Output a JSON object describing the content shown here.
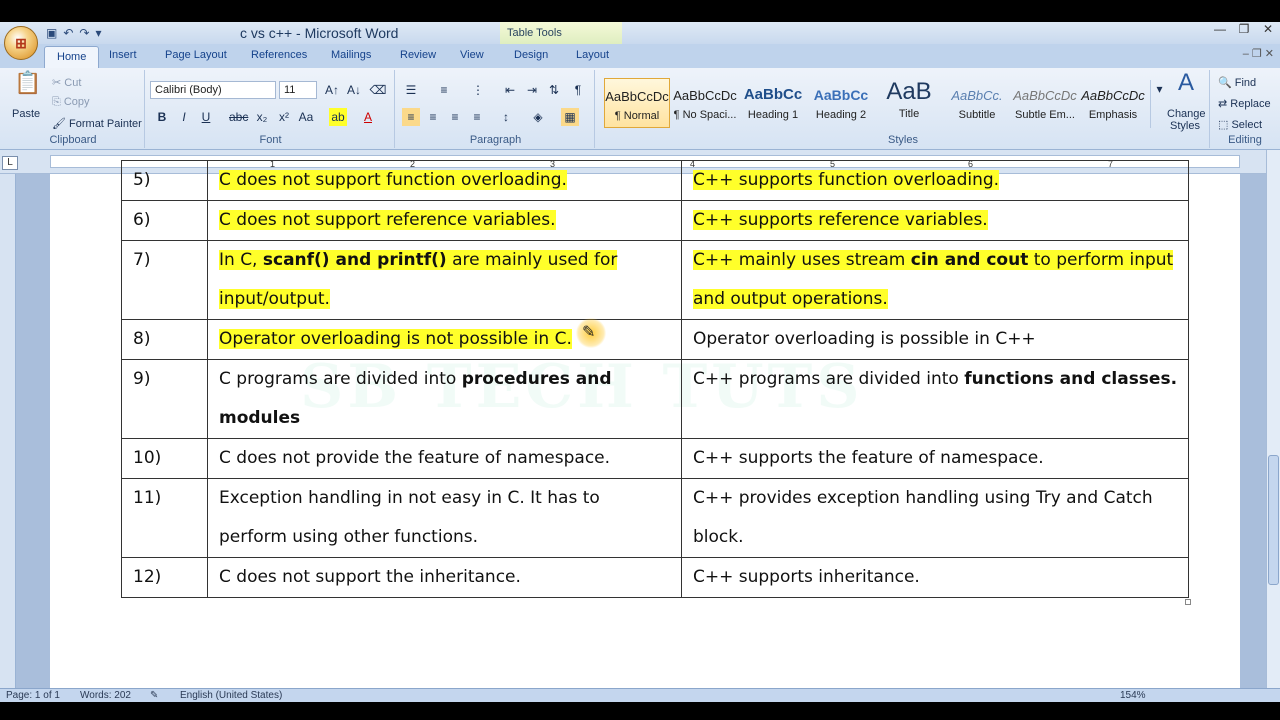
{
  "window": {
    "title": "c vs c++ - Microsoft Word",
    "contextual_tab_group": "Table Tools"
  },
  "tabs": [
    "Home",
    "Insert",
    "Page Layout",
    "References",
    "Mailings",
    "Review",
    "View",
    "Design",
    "Layout"
  ],
  "ribbon": {
    "clipboard": {
      "label": "Clipboard",
      "paste": "Paste",
      "cut": "Cut",
      "copy": "Copy",
      "format_painter": "Format Painter"
    },
    "font": {
      "label": "Font",
      "family": "Calibri (Body)",
      "size": "11"
    },
    "paragraph": {
      "label": "Paragraph"
    },
    "styles": {
      "label": "Styles",
      "items": [
        {
          "sample": "AaBbCcDc",
          "name": "¶ Normal"
        },
        {
          "sample": "AaBbCcDc",
          "name": "¶ No Spaci..."
        },
        {
          "sample": "AaBbCc",
          "name": "Heading 1"
        },
        {
          "sample": "AaBbCc",
          "name": "Heading 2"
        },
        {
          "sample": "AaB",
          "name": "Title"
        },
        {
          "sample": "AaBbCc.",
          "name": "Subtitle"
        },
        {
          "sample": "AaBbCcDc",
          "name": "Subtle Em..."
        },
        {
          "sample": "AaBbCcDc",
          "name": "Emphasis"
        }
      ],
      "change_styles": "Change Styles"
    },
    "editing": {
      "label": "Editing",
      "find": "Find",
      "replace": "Replace",
      "select": "Select"
    }
  },
  "ruler": {
    "numbers": [
      "1",
      "2",
      "3",
      "4",
      "5",
      "6",
      "7"
    ]
  },
  "table": {
    "rows": [
      {
        "num": "5)",
        "c_lines": [
          [
            {
              "t": "C does not support function overloading.",
              "hl": true
            }
          ]
        ],
        "cpp_lines": [
          [
            {
              "t": "C++ supports function overloading.",
              "hl": true
            }
          ]
        ]
      },
      {
        "num": "6)",
        "c_lines": [
          [
            {
              "t": "C does not support reference variables.",
              "hl": true
            }
          ]
        ],
        "cpp_lines": [
          [
            {
              "t": "C++ supports reference variables.",
              "hl": true
            }
          ]
        ]
      },
      {
        "num": "7)",
        "c_lines": [
          [
            {
              "t": "In C, ",
              "hl": true
            },
            {
              "t": "scanf() and printf()",
              "hl": true,
              "b": true
            },
            {
              "t": " are mainly used for",
              "hl": true
            }
          ],
          [
            {
              "t": "input/output.",
              "hl": true
            }
          ]
        ],
        "cpp_lines": [
          [
            {
              "t": "C++ mainly uses stream ",
              "hl": true
            },
            {
              "t": "cin and cout",
              "hl": true,
              "b": true
            },
            {
              "t": " to perform input",
              "hl": true
            }
          ],
          [
            {
              "t": "and output operations.",
              "hl": true
            }
          ]
        ]
      },
      {
        "num": "8)",
        "c_lines": [
          [
            {
              "t": "Operator overloading is not possible in C.",
              "hl": true
            }
          ]
        ],
        "cpp_lines": [
          [
            {
              "t": "Operator overloading is possible in C++"
            }
          ]
        ]
      },
      {
        "num": "9)",
        "c_lines": [
          [
            {
              "t": "C programs are divided into "
            },
            {
              "t": "procedures and",
              "b": true
            }
          ],
          [
            {
              "t": "modules",
              "b": true
            }
          ]
        ],
        "cpp_lines": [
          [
            {
              "t": "C++ programs are divided into "
            },
            {
              "t": "functions and classes.",
              "b": true
            }
          ]
        ]
      },
      {
        "num": "10)",
        "c_lines": [
          [
            {
              "t": "C does not provide the feature of namespace."
            }
          ]
        ],
        "cpp_lines": [
          [
            {
              "t": "C++ supports the feature of namespace."
            }
          ]
        ]
      },
      {
        "num": "11)",
        "c_lines": [
          [
            {
              "t": "Exception handling in not easy in C. It has to"
            }
          ],
          [
            {
              "t": "perform using other functions."
            }
          ]
        ],
        "cpp_lines": [
          [
            {
              "t": "C++ provides exception handling using Try and Catch"
            }
          ],
          [
            {
              "t": "block."
            }
          ]
        ]
      },
      {
        "num": "12)",
        "c_lines": [
          [
            {
              "t": "C does not support the inheritance."
            }
          ]
        ],
        "cpp_lines": [
          [
            {
              "t": "C++ supports inheritance."
            }
          ]
        ]
      }
    ]
  },
  "watermark": "SB TECH TUTS",
  "status": {
    "page": "Page: 1 of 1",
    "words": "Words: 202",
    "language": "English (United States)",
    "zoom": "154%"
  }
}
